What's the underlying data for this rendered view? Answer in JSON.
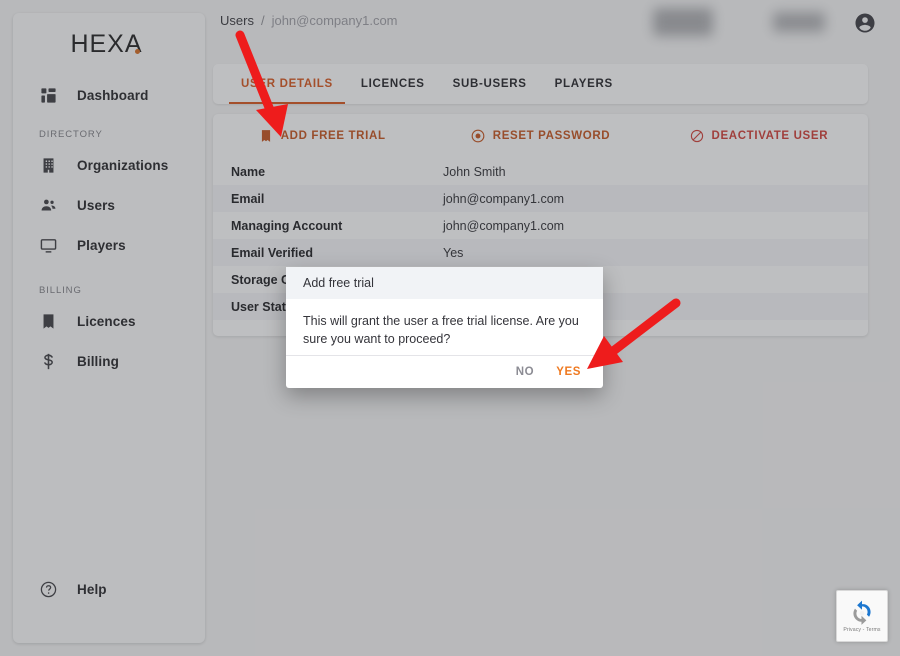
{
  "app": {
    "logo_text": "HEXA",
    "accent_color": "#d2521a",
    "danger_color": "#cc3b33",
    "yes_color": "#ef7a21"
  },
  "sidebar": {
    "sections": [
      {
        "label": "",
        "items": [
          {
            "icon": "dashboard-icon",
            "label": "Dashboard"
          }
        ]
      },
      {
        "label": "DIRECTORY",
        "items": [
          {
            "icon": "organizations-icon",
            "label": "Organizations"
          },
          {
            "icon": "users-icon",
            "label": "Users"
          },
          {
            "icon": "players-icon",
            "label": "Players"
          }
        ]
      },
      {
        "label": "BILLING",
        "items": [
          {
            "icon": "licences-icon",
            "label": "Licences"
          },
          {
            "icon": "billing-icon",
            "label": "Billing"
          }
        ]
      }
    ],
    "help": {
      "icon": "help-icon",
      "label": "Help"
    }
  },
  "header": {
    "breadcrumb": {
      "parent": "Users",
      "separator": "/",
      "current": "john@company1.com"
    },
    "account_icon": "account-circle-icon"
  },
  "tabs": [
    {
      "label": "USER DETAILS",
      "active": true
    },
    {
      "label": "LICENCES",
      "active": false
    },
    {
      "label": "SUB-USERS",
      "active": false
    },
    {
      "label": "PLAYERS",
      "active": false
    }
  ],
  "actions": [
    {
      "icon": "bookmark-icon",
      "label": "ADD FREE TRIAL",
      "style": "accent"
    },
    {
      "icon": "reset-password-icon",
      "label": "RESET PASSWORD",
      "style": "accent"
    },
    {
      "icon": "block-icon",
      "label": "DEACTIVATE USER",
      "style": "danger"
    }
  ],
  "details": {
    "rows": [
      {
        "key": "Name",
        "value": "John Smith"
      },
      {
        "key": "Email",
        "value": "john@company1.com"
      },
      {
        "key": "Managing Account",
        "value": "john@company1.com"
      },
      {
        "key": "Email Verified",
        "value": "Yes"
      },
      {
        "key": "Storage Co",
        "value": ""
      },
      {
        "key": "User Statu",
        "value": ""
      }
    ]
  },
  "dialog": {
    "title": "Add free trial",
    "body": "This will grant the user a free trial license. Are you sure you want to proceed?",
    "no_label": "NO",
    "yes_label": "YES"
  },
  "recaptcha": {
    "text": "Privacy - Terms",
    "icon": "recaptcha-icon"
  }
}
